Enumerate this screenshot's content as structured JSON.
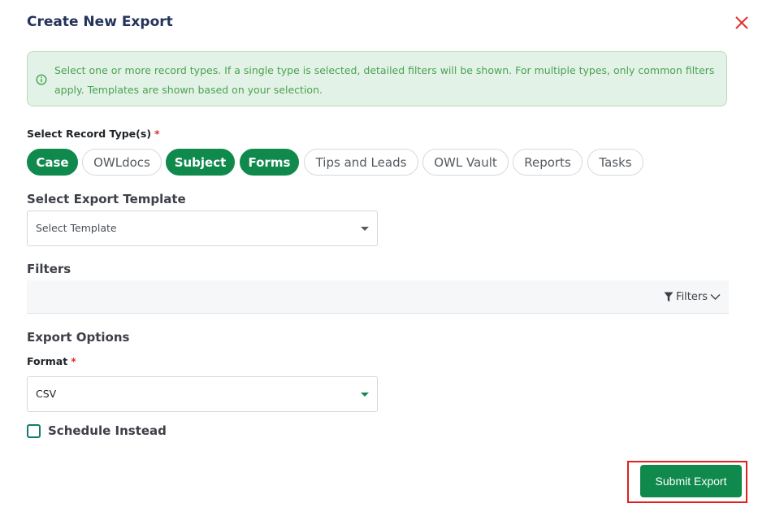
{
  "dialog": {
    "title": "Create New Export",
    "close_icon": "close-icon"
  },
  "info": {
    "icon": "info-circle-icon",
    "text": "Select one or more record types. If a single type is selected, detailed filters will be shown. For multiple types, only common filters apply. Templates are shown based on your selection."
  },
  "record_types": {
    "label": "Select Record Type(s)",
    "required_mark": "*",
    "options": [
      {
        "label": "Case",
        "selected": true
      },
      {
        "label": "OWLdocs",
        "selected": false
      },
      {
        "label": "Subject",
        "selected": true
      },
      {
        "label": "Forms",
        "selected": true
      },
      {
        "label": "Tips and Leads",
        "selected": false
      },
      {
        "label": "OWL Vault",
        "selected": false
      },
      {
        "label": "Reports",
        "selected": false
      },
      {
        "label": "Tasks",
        "selected": false
      }
    ]
  },
  "template": {
    "label": "Select Export Template",
    "value": "Select Template"
  },
  "filters": {
    "label": "Filters",
    "button_label": "Filters",
    "icon": "funnel-icon",
    "toggle_icon": "chevron-down-icon"
  },
  "export_options": {
    "label": "Export Options",
    "format_label": "Format",
    "required_mark": "*",
    "format_value": "CSV"
  },
  "schedule": {
    "label": "Schedule Instead",
    "checked": false
  },
  "submit": {
    "label": "Submit Export"
  },
  "colors": {
    "accent": "#0f8a4c",
    "title": "#24335a",
    "info_bg": "#e3f2e6",
    "info_text": "#4aa253",
    "required": "#e03131",
    "highlight": "#e0201f"
  }
}
